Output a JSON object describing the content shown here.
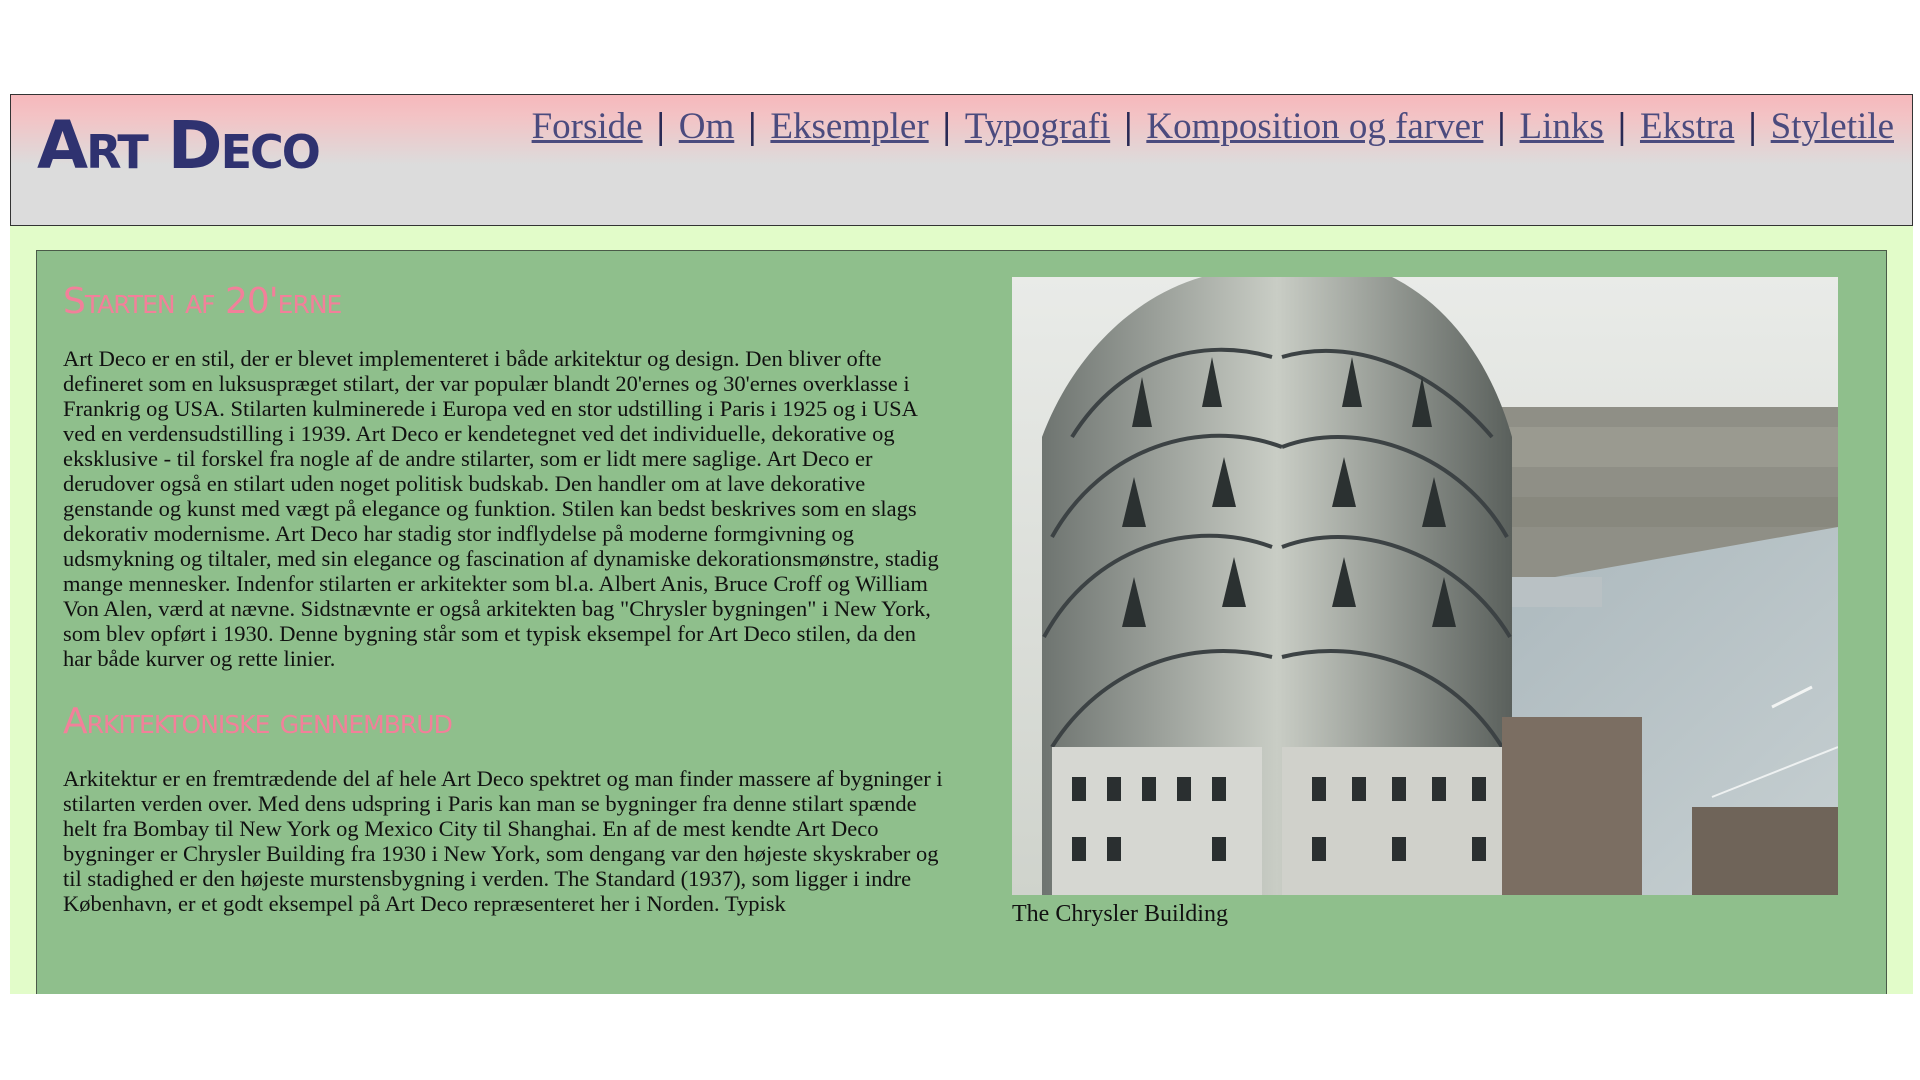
{
  "header": {
    "logo": "Art Deco",
    "nav": [
      "Forside",
      "Om",
      "Eksempler",
      "Typografi",
      "Komposition og farver",
      "Links",
      "Ekstra",
      "Styletile"
    ],
    "separator": "|"
  },
  "sections": [
    {
      "heading": "Starten af 20'erne",
      "body": "Art Deco er en stil, der er blevet implementeret i både arkitektur og design. Den bliver ofte defineret som en luksuspræget stilart, der var populær blandt 20'ernes og 30'ernes overklasse i Frankrig og USA. Stilarten kulminerede i Europa ved en stor udstilling i Paris i 1925 og i USA ved en verdensudstilling i 1939. Art Deco er kendetegnet ved det individuelle, dekorative og eksklusive - til forskel fra nogle af de andre stilarter, som er lidt mere saglige. Art Deco er derudover også en stilart uden noget politisk budskab. Den handler om at lave dekorative genstande og kunst med vægt på elegance og funktion. Stilen kan bedst beskrives som en slags dekorativ modernisme. Art Deco har stadig stor indflydelse på moderne formgivning og udsmykning og tiltaler, med sin elegance og fascination af dynamiske dekorationsmønstre, stadig mange mennesker. Indenfor stilarten er arkitekter som bl.a. Albert Anis, Bruce Croff og William Von Alen, værd at nævne. Sidstnævnte er også arkitekten bag \"Chrysler bygningen\" i New York, som blev opført i 1930. Denne bygning står som et typisk eksempel for Art Deco stilen, da den har både kurver og rette linier."
    },
    {
      "heading": "Arkitektoniske gennembrud",
      "body": "Arkitektur er en fremtrædende del af hele Art Deco spektret og man finder massere af bygninger i stilarten verden over. Med dens udspring i Paris kan man se bygninger fra denne stilart spænde helt fra Bombay til New York og Mexico City til Shanghai. En af de mest kendte Art Deco bygninger er Chrysler Building fra 1930 i New York, som dengang var den højeste skyskraber og til stadighed er den højeste murstensbygning i verden. The Standard (1937), som ligger i indre København, er et godt eksempel på Art Deco repræsenteret her i Norden. Typisk"
    }
  ],
  "figure": {
    "caption": "The Chrysler Building"
  }
}
